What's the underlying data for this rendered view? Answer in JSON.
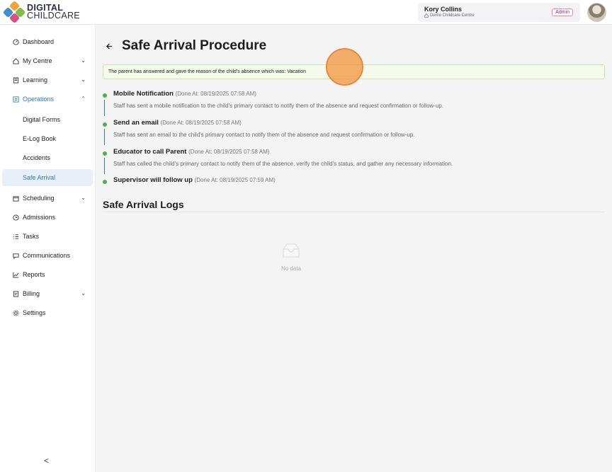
{
  "app": {
    "logo_line1": "DIGITAL",
    "logo_line2": "CHILDCARE"
  },
  "user": {
    "name": "Kory Collins",
    "centre": "Demo Childcare Centre",
    "role": "Admin"
  },
  "sidebar": {
    "items": [
      {
        "label": "Dashboard",
        "icon": "dashboard-icon"
      },
      {
        "label": "My Centre",
        "icon": "home-icon"
      },
      {
        "label": "Learning",
        "icon": "book-icon"
      },
      {
        "label": "Operations",
        "icon": "operations-icon"
      },
      {
        "label": "Scheduling",
        "icon": "calendar-icon"
      },
      {
        "label": "Admissions",
        "icon": "admissions-icon"
      },
      {
        "label": "Tasks",
        "icon": "tasks-icon"
      },
      {
        "label": "Communications",
        "icon": "chat-icon"
      },
      {
        "label": "Reports",
        "icon": "chart-icon"
      },
      {
        "label": "Billing",
        "icon": "billing-icon"
      },
      {
        "label": "Settings",
        "icon": "gear-icon"
      }
    ],
    "operations_sub": [
      "Digital Forms",
      "E-Log Book",
      "Accidents",
      "Safe Arrival"
    ],
    "collapse": "<"
  },
  "page": {
    "title": "Safe Arrival Procedure",
    "alert": "The parent has answered and gave the reason of the child's absence which was: Vacation"
  },
  "steps": [
    {
      "title": "Mobile Notification",
      "done": "(Done At: 08/19/2025 07:58 AM)",
      "desc": "Staff has sent a mobile notification to the child's primary contact to notify them of the absence and request confirmation or follow-up."
    },
    {
      "title": "Send an email",
      "done": "(Done At: 08/19/2025 07:58 AM)",
      "desc": "Staff has sent an email to the child's primary contact to notify them of the absence and request confirmation or follow-up."
    },
    {
      "title": "Educator to call Parent",
      "done": "(Done At: 08/19/2025 07:58 AM)",
      "desc": "Staff has called the child's primary contact to notify them of the absence, verify the child's status, and gather any necessary information."
    },
    {
      "title": "Supervisor will follow up",
      "done": "(Done At: 08/19/2025 07:59 AM)",
      "desc": ""
    }
  ],
  "logs": {
    "title": "Safe Arrival Logs",
    "empty": "No data"
  },
  "colors": {
    "accent": "#2f79b9",
    "success": "#4caf50",
    "alert_bg": "#f4fbea",
    "admin_badge": "#c2185b"
  }
}
